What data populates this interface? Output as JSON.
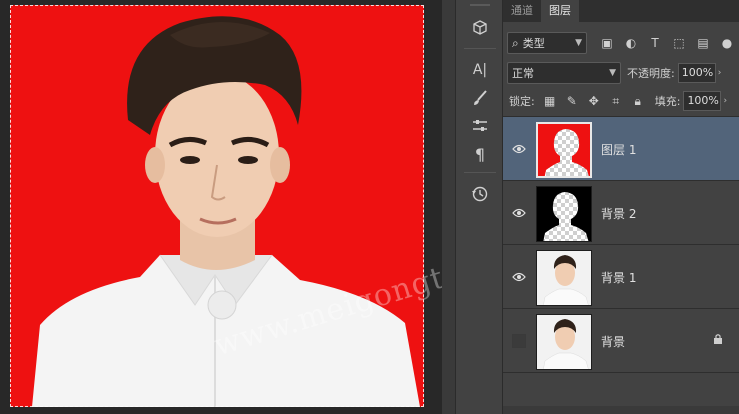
{
  "canvas": {
    "background_color": "#ee1111",
    "watermark": "www.meigongtt.com"
  },
  "toolbar": {
    "tools": [
      {
        "name": "3d-cube-icon",
        "glyph": "⬡"
      },
      {
        "name": "character-icon",
        "glyph": "A|"
      },
      {
        "name": "brush-settings-icon",
        "glyph": "✎"
      },
      {
        "name": "adjustments-icon",
        "glyph": "☰"
      },
      {
        "name": "paragraph-icon",
        "glyph": "¶"
      },
      {
        "name": "history-icon",
        "glyph": "⟲"
      }
    ]
  },
  "panel": {
    "tabs": [
      {
        "label": "通道",
        "active": false
      },
      {
        "label": "图层",
        "active": true
      }
    ],
    "kind_filter": "类型",
    "blend_mode": "正常",
    "opacity_label": "不透明度:",
    "opacity_value": "100%",
    "lock_label": "锁定:",
    "fill_label": "填充:",
    "fill_value": "100%",
    "layers": [
      {
        "name": "图层 1",
        "visible": true,
        "selected": true,
        "locked": false
      },
      {
        "name": "背景 2",
        "visible": true,
        "selected": false,
        "locked": false
      },
      {
        "name": "背景 1",
        "visible": true,
        "selected": false,
        "locked": false
      },
      {
        "name": "背景",
        "visible": false,
        "selected": false,
        "locked": true
      }
    ]
  },
  "colors": {
    "selection": "#52647a",
    "red_fill": "#ee1111"
  }
}
